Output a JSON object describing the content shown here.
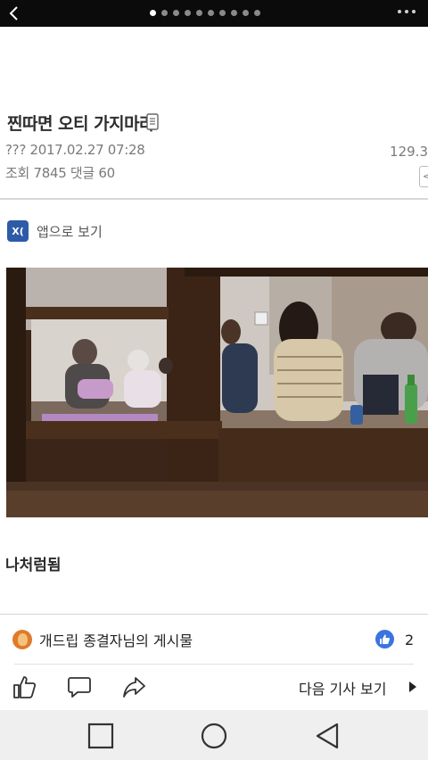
{
  "topbar": {
    "back_icon": "chevron-left-icon",
    "page_dots_total": 10,
    "page_dots_active": 1,
    "more_icon": "more-dots-icon"
  },
  "article": {
    "title": "찐따면 오티 가지마라",
    "title_icon": "document-icon",
    "meta_date": "??? 2017.02.27 07:28",
    "meta_right": "129.3",
    "meta_stats": "조회 7845 댓글 60",
    "body_text": "나처럼됨"
  },
  "app_view": {
    "logo_text": "X(",
    "label": "앱으로 보기"
  },
  "footer": {
    "author_label": "개드립 종결자님의 게시물",
    "like_count": "2",
    "next_article_label": "다음 기사 보기",
    "colors": {
      "like_blue": "#3b74e0",
      "avatar_orange": "#e07a2c"
    }
  },
  "navbar": {
    "buttons": [
      "recent-apps-icon",
      "home-icon",
      "back-icon"
    ]
  }
}
